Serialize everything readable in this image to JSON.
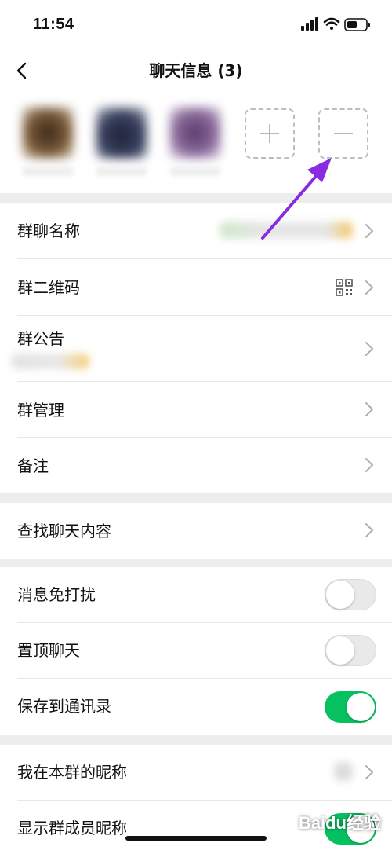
{
  "status_bar": {
    "time": "11:54"
  },
  "nav": {
    "title": "聊天信息 (3)"
  },
  "members": {
    "add_icon": "plus-icon",
    "remove_icon": "minus-icon"
  },
  "rows": {
    "group_name": "群聊名称",
    "qr_code": "群二维码",
    "announcement": "群公告",
    "management": "群管理",
    "remark": "备注",
    "search_chat": "查找聊天内容",
    "mute": "消息免打扰",
    "pin": "置顶聊天",
    "save_contacts": "保存到通讯录",
    "my_nickname": "我在本群的昵称",
    "show_nicknames": "显示群成员昵称"
  },
  "toggles": {
    "mute": false,
    "pin": false,
    "save_contacts": true,
    "show_nicknames": true
  },
  "colors": {
    "accent": "#07c160",
    "annotation_arrow": "#8a2be2"
  },
  "watermark": {
    "text": "Baidu经验"
  }
}
